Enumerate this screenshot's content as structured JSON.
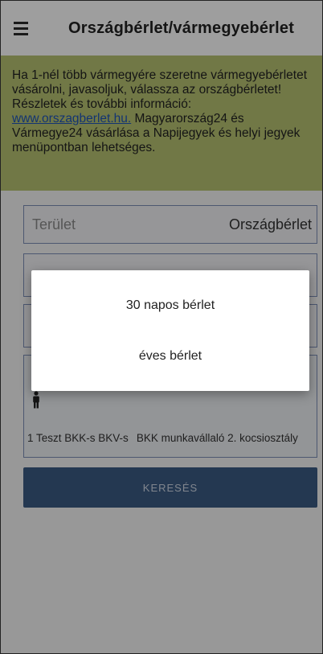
{
  "header": {
    "title": "Országbérlet/vármegyebérlet",
    "menu_icon": "hamburger-menu-icon"
  },
  "banner": {
    "line1": "Ha 1-nél több vármegyére szeretne vármegyebérletet vásárolni, javasoljuk, válassza az országbérletet!",
    "line2": "Részletek és további információ:",
    "link": "www.orszagberlet.hu.",
    "line3": " Magyarország24 és Vármegye24 vásárlása a Napijegyek és helyi jegyek menüpontban lehetséges.",
    "color": "#b6c271"
  },
  "form": {
    "area_label": "Terület",
    "area_value": "Országbérlet",
    "passenger_icon": "person-icon",
    "passenger_name": "1 Teszt BKK-s BKV-s",
    "passenger_discount": "BKK munkavállaló 2. kocsiosztály",
    "search_label": "KERESÉS"
  },
  "dialog": {
    "options": [
      "30 napos bérlet",
      "éves bérlet"
    ]
  }
}
